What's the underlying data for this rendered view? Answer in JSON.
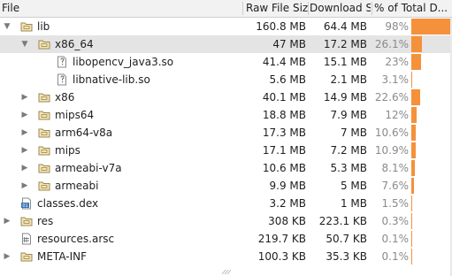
{
  "header": {
    "file": "File",
    "raw": "Raw File Size",
    "download": "Download Si...",
    "percent": "% of Total D..."
  },
  "rows": [
    {
      "name": "lib",
      "raw": "160.8 MB",
      "dl": "64.4 MB",
      "pct": "98%",
      "fraction": 0.98,
      "type": "folder",
      "depth": 0,
      "expander": "expanded",
      "selected": false
    },
    {
      "name": "x86_64",
      "raw": "47 MB",
      "dl": "17.2 MB",
      "pct": "26.1%",
      "fraction": 0.261,
      "type": "folder",
      "depth": 1,
      "expander": "expanded",
      "selected": true
    },
    {
      "name": "libopencv_java3.so",
      "raw": "41.4 MB",
      "dl": "15.1 MB",
      "pct": "23%",
      "fraction": 0.23,
      "type": "file",
      "depth": 2,
      "expander": "none",
      "selected": false
    },
    {
      "name": "libnative-lib.so",
      "raw": "5.6 MB",
      "dl": "2.1 MB",
      "pct": "3.1%",
      "fraction": 0.031,
      "type": "file",
      "depth": 2,
      "expander": "none",
      "selected": false
    },
    {
      "name": "x86",
      "raw": "40.1 MB",
      "dl": "14.9 MB",
      "pct": "22.6%",
      "fraction": 0.226,
      "type": "folder",
      "depth": 1,
      "expander": "collapsed",
      "selected": false
    },
    {
      "name": "mips64",
      "raw": "18.8 MB",
      "dl": "7.9 MB",
      "pct": "12%",
      "fraction": 0.12,
      "type": "folder",
      "depth": 1,
      "expander": "collapsed",
      "selected": false
    },
    {
      "name": "arm64-v8a",
      "raw": "17.3 MB",
      "dl": "7 MB",
      "pct": "10.6%",
      "fraction": 0.106,
      "type": "folder",
      "depth": 1,
      "expander": "collapsed",
      "selected": false
    },
    {
      "name": "mips",
      "raw": "17.1 MB",
      "dl": "7.2 MB",
      "pct": "10.9%",
      "fraction": 0.109,
      "type": "folder",
      "depth": 1,
      "expander": "collapsed",
      "selected": false
    },
    {
      "name": "armeabi-v7a",
      "raw": "10.6 MB",
      "dl": "5.3 MB",
      "pct": "8.1%",
      "fraction": 0.081,
      "type": "folder",
      "depth": 1,
      "expander": "collapsed",
      "selected": false
    },
    {
      "name": "armeabi",
      "raw": "9.9 MB",
      "dl": "5 MB",
      "pct": "7.6%",
      "fraction": 0.076,
      "type": "folder",
      "depth": 1,
      "expander": "collapsed",
      "selected": false
    },
    {
      "name": "classes.dex",
      "raw": "3.2 MB",
      "dl": "1 MB",
      "pct": "1.5%",
      "fraction": 0.015,
      "type": "dex",
      "depth": 0,
      "expander": "none",
      "selected": false
    },
    {
      "name": "res",
      "raw": "308 KB",
      "dl": "223.1 KB",
      "pct": "0.3%",
      "fraction": 0.003,
      "type": "folder",
      "depth": 0,
      "expander": "collapsed",
      "selected": false
    },
    {
      "name": "resources.arsc",
      "raw": "219.7 KB",
      "dl": "50.7 KB",
      "pct": "0.1%",
      "fraction": 0.001,
      "type": "arsc",
      "depth": 0,
      "expander": "none",
      "selected": false
    },
    {
      "name": "META-INF",
      "raw": "100.3 KB",
      "dl": "35.3 KB",
      "pct": "0.1%",
      "fraction": 0.001,
      "type": "folder",
      "depth": 0,
      "expander": "collapsed",
      "selected": false
    }
  ],
  "icons": {
    "folder": "folder-icon",
    "file": "file-icon",
    "dex": "dex-file-icon",
    "arsc": "arsc-file-icon",
    "expanded": "chevron-down-icon",
    "collapsed": "chevron-right-icon"
  },
  "colors": {
    "bar": "#f5913a",
    "selection": "#e4e4e4",
    "folder_fill": "#f5e6b8",
    "folder_stroke": "#9a8850",
    "dex_badge": "#3a74b8",
    "percent_text": "#8a8a8a"
  }
}
